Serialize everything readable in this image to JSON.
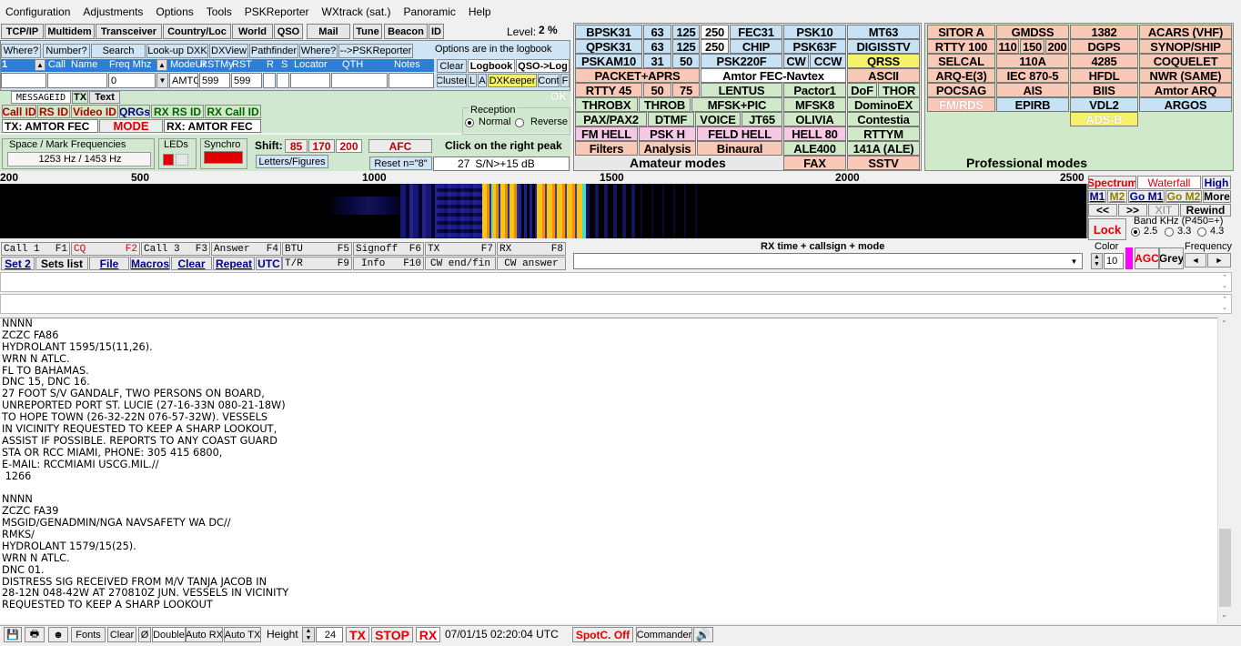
{
  "menu": [
    "Configuration",
    "Adjustments",
    "Options",
    "Tools",
    "PSKReporter",
    "WXtrack (sat.)",
    "Panoramic",
    "Help"
  ],
  "toolbar": {
    "buttons": [
      "TCP/IP",
      "Multidem",
      "Transceiver",
      "Country/Loc",
      "World",
      "QSO",
      "Mail",
      "Tune",
      "Beacon",
      "ID"
    ],
    "level_label": "Level:",
    "level_value": "2 %"
  },
  "log": {
    "buttons": [
      "Where?",
      "Number?",
      "Search",
      "Look-up DXK",
      "DXView",
      "Pathfinder",
      "Where?",
      "-->PSKReporter"
    ],
    "options_note": "Options are in the logbook",
    "clear": "Clear",
    "logbook": "Logbook",
    "qso_log": "QSO->Log",
    "cluster": "Cluster",
    "l": "L",
    "a": "A",
    "dxkeeper": "DXKeeper",
    "cont": "Cont",
    "f": "F",
    "headers": [
      "Call",
      "Name",
      "Freq Mhz",
      "ModeUr",
      "RSTMy",
      "RST",
      "R",
      "S",
      "Locator",
      "QTH",
      "Notes"
    ],
    "row_number": "1",
    "freq_value": "0",
    "mode_value": "AMTC",
    "rst_ur": "599",
    "rst_my": "599"
  },
  "msg_tabs": {
    "messageid": "MESSAGEID",
    "tx": "TX",
    "text": "Text",
    "ok": "OK"
  },
  "id_buttons": [
    "Call ID",
    "RS ID",
    "Video ID",
    "QRGs",
    "RX RS ID",
    "RX Call ID"
  ],
  "mode_row": {
    "tx": "TX: AMTOR FEC",
    "mode": "MODE",
    "rx": "RX: AMTOR FEC"
  },
  "reception": {
    "title": "Reception",
    "normal": "Normal",
    "reverse": "Reverse"
  },
  "freq_panel": {
    "space_mark": "Space / Mark Frequencies",
    "space_mark_value": "1253 Hz / 1453 Hz",
    "leds": "LEDs",
    "synchro": "Synchro",
    "shift": "Shift:",
    "shifts": [
      "85",
      "170",
      "200"
    ],
    "afc": "AFC",
    "click_peak": "Click on the right peak",
    "letters_figures": "Letters/Figures",
    "reset": "Reset n=\"8\"",
    "snr_num": "27",
    "snr": "S/N>+15 dB"
  },
  "amateur_modes": {
    "footer": "Amateur modes",
    "rows": [
      [
        "BPSK31",
        "63",
        "125",
        "250",
        "FEC31",
        "PSK10",
        "MT63"
      ],
      [
        "QPSK31",
        "63",
        "125",
        "250",
        "CHIP",
        "PSK63F",
        "DIGISSTV"
      ],
      [
        "PSKAM10",
        "31",
        "50",
        "PSK220F",
        "CW",
        "CCW",
        "QRSS"
      ],
      [
        "PACKET+APRS",
        "Amtor FEC-Navtex",
        "ASCII"
      ],
      [
        "RTTY 45",
        "50",
        "75",
        "LENTUS",
        "Pactor1",
        "DoF",
        "THOR"
      ],
      [
        "THROBX",
        "THROB",
        "MFSK+PIC",
        "MFSK8",
        "DominoEX"
      ],
      [
        "PAX/PAX2",
        "DTMF",
        "VOICE",
        "JT65",
        "OLIVIA",
        "Contestia"
      ],
      [
        "FM HELL",
        "PSK H",
        "FELD HELL",
        "HELL 80",
        "RTTYM"
      ],
      [
        "Filters",
        "Analysis",
        "Binaural",
        "ALE400",
        "141A (ALE)"
      ],
      [
        "FAX",
        "SSTV"
      ]
    ]
  },
  "pro_modes": {
    "footer": "Professional modes",
    "rows": [
      [
        "SITOR A",
        "GMDSS",
        "1382",
        "ACARS (VHF)"
      ],
      [
        "RTTY 100",
        "110",
        "150",
        "200",
        "DGPS",
        "SYNOP/SHIP"
      ],
      [
        "SELCAL",
        "110A",
        "4285",
        "COQUELET"
      ],
      [
        "ARQ-E(3)",
        "IEC 870-5",
        "HFDL",
        "NWR (SAME)"
      ],
      [
        "POCSAG",
        "AIS",
        "BIIS",
        "Amtor ARQ"
      ],
      [
        "FM/RDS",
        "EPIRB",
        "VDL2",
        "ARGOS"
      ],
      [
        "ADS-B"
      ]
    ]
  },
  "scale": {
    "ticks": [
      "200",
      "500",
      "1000",
      "1500",
      "2000",
      "2500"
    ]
  },
  "waterfall_panel": {
    "spectrum": "Spectrum",
    "waterfall": "Waterfall",
    "high": "High",
    "m1": "M1",
    "m2": "M2",
    "go_m1": "Go M1",
    "go_m2": "Go M2",
    "more": "More",
    "prev": "<<",
    "next": ">>",
    "xit": "XIT",
    "rewind": "Rewind",
    "lock": "Lock",
    "band_khz": "Band KHz (P450=+)",
    "band_opts": [
      "2.5",
      "3.3",
      "4.3"
    ],
    "color": "Color",
    "color_value": "10",
    "agc": "AGC",
    "grey": "Grey",
    "frequency": "Frequency",
    "left": "◄",
    "right": "►"
  },
  "fkeys": {
    "row1": [
      [
        "Call 1",
        "F1"
      ],
      [
        "CQ",
        "F2"
      ],
      [
        "Call 3",
        "F3"
      ],
      [
        "Answer",
        "F4"
      ],
      [
        "BTU",
        "F5"
      ],
      [
        "Signoff",
        "F6"
      ],
      [
        "TX",
        "F7"
      ],
      [
        "RX",
        "F8"
      ]
    ],
    "row2": [
      "Set 2",
      "Sets list",
      "File",
      "Macros",
      "Clear",
      "Repeat",
      "UTC"
    ],
    "row2b": [
      [
        "T/R",
        "F9"
      ],
      [
        "Info",
        "F10"
      ],
      [
        "CW end/fin",
        ""
      ],
      [
        "CW answer",
        ""
      ]
    ]
  },
  "rx_header": "RX time + callsign + mode",
  "rx_lines": [
    "NNNN",
    "ZCZC FA86",
    "HYDROLANT 1595/15(11,26).",
    "WRN N ATLC.",
    "FL TO BAHAMAS.",
    "DNC 15, DNC 16.",
    "27 FOOT S/V GANDALF, TWO PERSONS ON BOARD,",
    "UNREPORTED PORT ST. LUCIE (27-16-33N 080-21-18W)",
    "TO HOPE TOWN (26-32-22N 076-57-32W). VESSELS",
    "IN VICINITY REQUESTED TO KEEP A SHARP LOOKOUT,",
    "ASSIST IF POSSIBLE. REPORTS TO ANY COAST GUARD",
    "STA OR RCC MIAMI, PHONE: 305 415 6800,",
    "E-MAIL: RCCMIAMI USCG.MIL.//",
    " 1266",
    "",
    "NNNN",
    "ZCZC FA39",
    "MSGID/GENADMIN/NGA NAVSAFETY WA DC//",
    "RMKS/",
    "HYDROLANT 1579/15(25).",
    "WRN N ATLC.",
    "DNC 01.",
    "DISTRESS SIG RECEIVED FROM M/V TANJA JACOB IN",
    "28-12N 048-42W AT 270810Z JUN. VESSELS IN VICINITY",
    "REQUESTED TO KEEP A SHARP LOOKOUT"
  ],
  "status": {
    "fonts": "Fonts",
    "clear": "Clear",
    "zero": "Ø",
    "double": "Double",
    "auto_rx": "Auto RX",
    "auto_tx": "Auto TX",
    "height": "Height",
    "height_value": "24",
    "tx": "TX",
    "stop": "STOP",
    "rx": "RX",
    "datetime": "07/01/15 02:20:04 UTC",
    "spotc": "SpotC. Off",
    "commander": "Commander"
  }
}
